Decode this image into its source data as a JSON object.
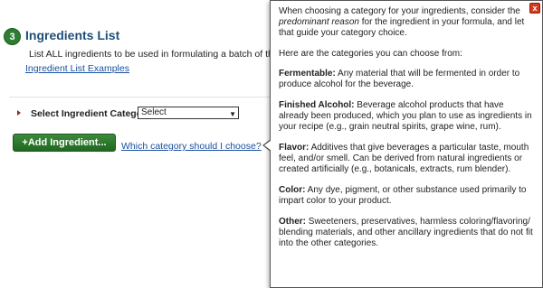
{
  "section": {
    "step_number": "3",
    "title": "Ingredients List",
    "description": "List ALL ingredients to be used in formulating a batch of th",
    "examples_link": "Ingredient List Examples"
  },
  "select": {
    "label": "Select Ingredient Category",
    "value": "Select"
  },
  "add_button_label": "+Add Ingredient...",
  "help_link": "Which category should I choose?",
  "popup": {
    "close_label": "x",
    "intro_a": "When choosing a category for your ingredients, consider the ",
    "intro_em": "predominant reason",
    "intro_b": " for the ingredient in your formula, and let that guide your category choice.",
    "categories_intro": "Here are the categories you can choose from:",
    "categories": [
      {
        "name": "Fermentable:",
        "desc": " Any material that will be fermented in order to produce alcohol for the beverage."
      },
      {
        "name": "Finished Alcohol:",
        "desc": " Beverage alcohol products that have already been produced, which you plan to use as ingredients in your recipe (e.g., grain neutral spirits, grape wine, rum)."
      },
      {
        "name": "Flavor:",
        "desc": " Additives that give beverages a particular taste, mouth feel, and/or smell. Can be derived from natural ingredients or created artificially (e.g., botanicals, extracts, rum blender)."
      },
      {
        "name": "Color:",
        "desc": " Any dye, pigment, or other substance used primarily to impart color to your product."
      },
      {
        "name": "Other:",
        "desc": " Sweeteners, preservatives, harmless coloring/flavoring/ blending materials, and other ancillary ingredients that do not fit into the other categories."
      }
    ]
  },
  "colors": {
    "title": "#1f4e79",
    "link": "#1a4fa0",
    "button": "#2a7a2a",
    "close": "#d63b1f"
  }
}
